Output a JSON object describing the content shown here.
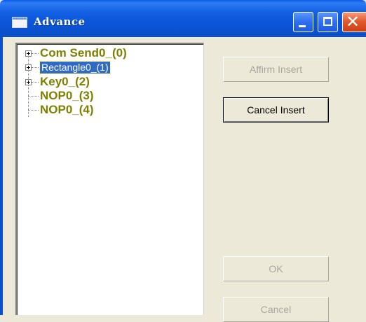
{
  "window": {
    "title": "Advance"
  },
  "tree": {
    "items": [
      {
        "label": "Com Send0_(0)",
        "expandable": true,
        "selected": false
      },
      {
        "label": "Rectangle0_(1)",
        "expandable": true,
        "selected": true
      },
      {
        "label": "Key0_(2)",
        "expandable": true,
        "selected": false
      },
      {
        "label": "NOP0_(3)",
        "expandable": false,
        "selected": false
      },
      {
        "label": "NOP0_(4)",
        "expandable": false,
        "selected": false
      }
    ]
  },
  "buttons": {
    "affirm_insert": "Affirm Insert",
    "cancel_insert": "Cancel Insert",
    "ok": "OK",
    "cancel": "Cancel"
  },
  "colors": {
    "titlebar": "#0b4fc9",
    "tree_text": "#808000",
    "selection": "#316ac5",
    "face": "#ece9d8"
  }
}
